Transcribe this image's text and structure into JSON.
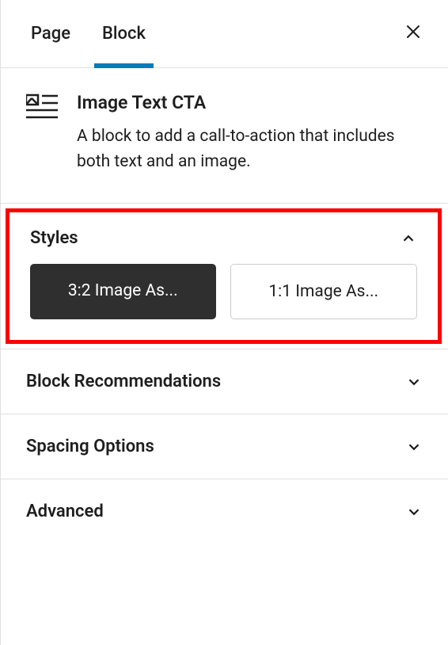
{
  "tabs": {
    "page": "Page",
    "block": "Block"
  },
  "block": {
    "title": "Image Text CTA",
    "description": "A block to add a call-to-action that includes both text and an image."
  },
  "panels": {
    "styles": {
      "title": "Styles",
      "options": {
        "first": "3:2 Image As...",
        "second": "1:1 Image As..."
      }
    },
    "recommendations": "Block Recommendations",
    "spacing": "Spacing Options",
    "advanced": "Advanced"
  }
}
